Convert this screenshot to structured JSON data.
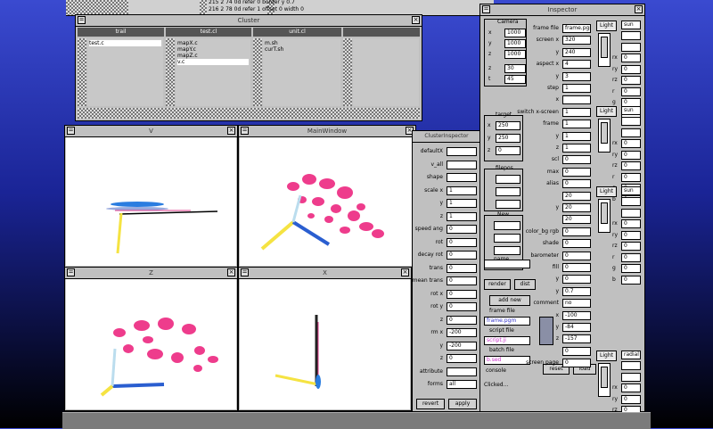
{
  "taskbar": {
    "items": [
      "",
      "",
      "",
      "",
      ""
    ]
  },
  "code_window": {
    "lines": [
      "215  2  74  0d    refer 0   border y 0.7",
      "216  2  78  0d    refer 1   offset 0 width 0"
    ]
  },
  "cluster": {
    "title": "Cluster",
    "columns": [
      {
        "header": "trail",
        "items": [
          "test.c"
        ]
      },
      {
        "header": "test.cl",
        "items": [
          "mapX.c",
          "mapY.c",
          "mapZ.c",
          "v.c"
        ]
      },
      {
        "header": "unit.cl",
        "items": [
          "m.sh",
          "curT.sh"
        ]
      },
      {
        "header": "",
        "items": []
      }
    ]
  },
  "views": {
    "v": {
      "title": "V"
    },
    "main": {
      "title": "MainWindow"
    },
    "z": {
      "title": "Z"
    },
    "x": {
      "title": "X"
    }
  },
  "cluster_inspector": {
    "title": "ClusterInspector",
    "fields": [
      {
        "label": "defaultX",
        "value": ""
      },
      {
        "label": "v_all",
        "value": ""
      },
      {
        "label": "shape",
        "value": ""
      },
      {
        "label": "scale x",
        "value": "1"
      },
      {
        "label": "y",
        "value": "1"
      },
      {
        "label": "z",
        "value": "1"
      },
      {
        "label": "speed ang",
        "value": "0"
      },
      {
        "label": "rot",
        "value": "0"
      },
      {
        "label": "decay rot",
        "value": "0"
      },
      {
        "label": "trans",
        "value": "0"
      },
      {
        "label": "mean trans",
        "value": "0"
      },
      {
        "label": "rot x",
        "value": "0"
      },
      {
        "label": "rot y",
        "value": "0"
      },
      {
        "label": "z",
        "value": "0"
      },
      {
        "label": "rm x",
        "value": "-200"
      },
      {
        "label": "y",
        "value": "-200"
      },
      {
        "label": "z",
        "value": "0"
      },
      {
        "label": "attribute",
        "value": ""
      },
      {
        "label": "forms",
        "value": "all"
      }
    ],
    "buttons": {
      "revert": "revert",
      "apply": "apply"
    }
  },
  "inspector": {
    "title": "Inspector",
    "camera": {
      "title": "Camera",
      "x": "1000",
      "y": "1000",
      "z": "1000",
      "zoom": "30",
      "twist": "45"
    },
    "target": {
      "title": "target",
      "x": "250",
      "y": "250",
      "z": "0"
    },
    "filepos": {
      "title": "filepos",
      "x": "",
      "y": "",
      "z": ""
    },
    "new": {
      "title": "New",
      "x": "",
      "y": "",
      "z": "",
      "name_label": "name"
    },
    "render_button": "render",
    "dist_button": "dist",
    "add_new_button": "add new",
    "frame_file": {
      "label": "frame file",
      "value": "frame.pgm"
    },
    "script_file": {
      "label": "script file",
      "value": "script.ji"
    },
    "batch_file": {
      "label": "batch file",
      "value": "b.sed"
    },
    "console_label": "console",
    "status": "Clicked...",
    "mid_fields": [
      {
        "label": "frame file",
        "value": "frame.pgm"
      },
      {
        "label": "screen x",
        "value": "320"
      },
      {
        "label": "y",
        "value": "240"
      },
      {
        "label": "aspect x",
        "value": "4"
      },
      {
        "label": "y",
        "value": "3"
      },
      {
        "label": "step",
        "value": "1"
      },
      {
        "label": "x",
        "value": ""
      },
      {
        "label": "switch x-screen",
        "value": "1"
      },
      {
        "label": "frame",
        "value": "1"
      },
      {
        "label": "y",
        "value": "1"
      },
      {
        "label": "z",
        "value": "1"
      },
      {
        "label": "scl",
        "value": "0"
      },
      {
        "label": "max",
        "value": "0"
      },
      {
        "label": "alias",
        "value": "0"
      },
      {
        "label": "",
        "value": "20"
      },
      {
        "label": "y",
        "value": "20"
      },
      {
        "label": "",
        "value": "20"
      },
      {
        "label": "color_bg rgb",
        "value": "0"
      },
      {
        "label": "shade",
        "value": "0"
      },
      {
        "label": "barometer",
        "value": "0"
      },
      {
        "label": "fill",
        "value": "0"
      },
      {
        "label": "y",
        "value": "0"
      },
      {
        "label": "y",
        "value": "0.7"
      },
      {
        "label": "comment",
        "value": "no"
      },
      {
        "label": "x",
        "value": "-100"
      },
      {
        "label": "y",
        "value": "-84"
      },
      {
        "label": "z",
        "value": "-157"
      },
      {
        "label": "",
        "value": "0"
      },
      {
        "label": "screen page",
        "value": "0"
      }
    ],
    "reset_button": "reset",
    "load_button": "load",
    "lights": [
      {
        "title": "Light",
        "mode": "sun",
        "fields": [
          "",
          "",
          "0",
          "0",
          "0",
          "0",
          "0",
          "0"
        ]
      },
      {
        "title": "Light",
        "mode": "sun",
        "fields": [
          "",
          "",
          "0",
          "0",
          "0",
          "0",
          "0",
          "0"
        ]
      },
      {
        "title": "Light",
        "mode": "sun",
        "fields": [
          "",
          "",
          "0",
          "0",
          "0",
          "0",
          "0",
          "0"
        ]
      },
      {
        "title": "Light",
        "mode": "radial",
        "fields": [
          "",
          "",
          "0",
          "0",
          "0"
        ]
      }
    ],
    "light_side_labels": [
      "",
      "",
      "rx",
      "ry",
      "rz",
      "r",
      "g",
      "b"
    ]
  }
}
